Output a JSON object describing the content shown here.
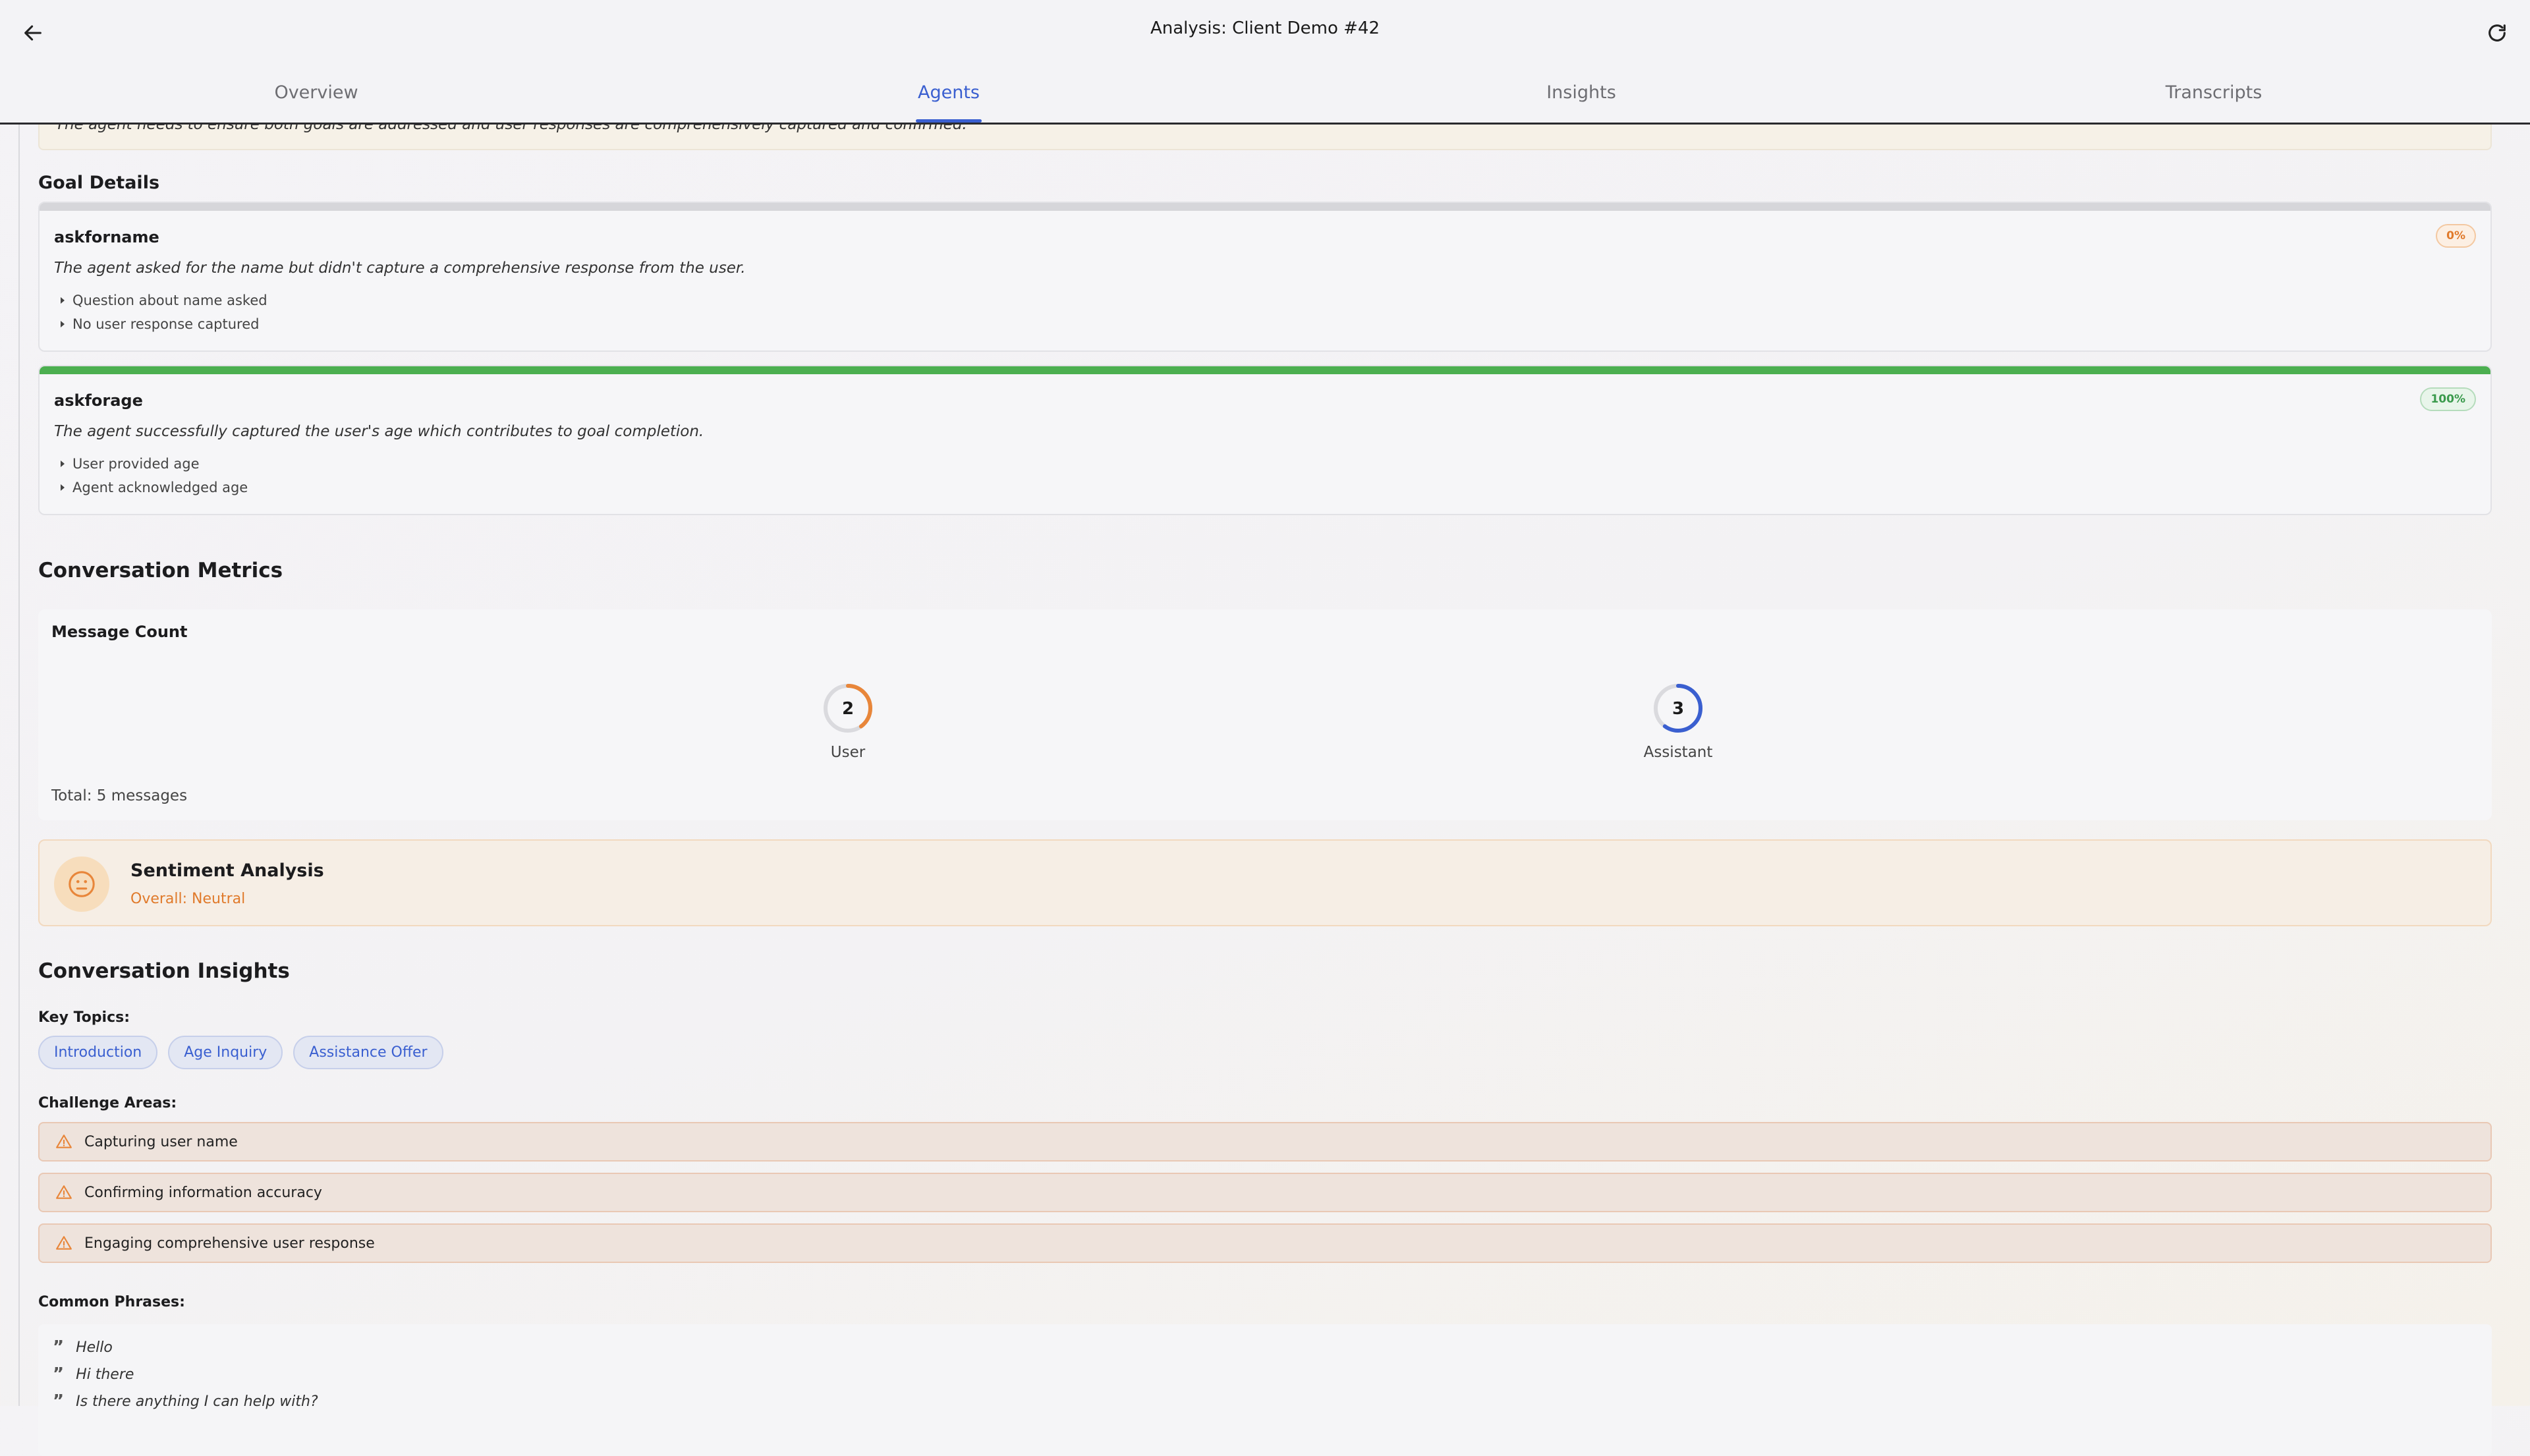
{
  "header": {
    "title": "Analysis: Client Demo #42",
    "tabs": [
      {
        "label": "Overview"
      },
      {
        "label": "Agents"
      },
      {
        "label": "Insights"
      },
      {
        "label": "Transcripts"
      }
    ],
    "active_tab": "Agents"
  },
  "banner": {
    "text": "The agent needs to ensure both goals are addressed and user responses are comprehensively captured and confirmed."
  },
  "goal_details": {
    "title": "Goal Details",
    "goals": [
      {
        "name": "askforname",
        "percent": 0,
        "percent_label": "0%",
        "description": "The agent asked for the name but didn't capture a comprehensive response from the user.",
        "points": [
          "Question about name asked",
          "No user response captured"
        ]
      },
      {
        "name": "askforage",
        "percent": 100,
        "percent_label": "100%",
        "description": "The agent successfully captured the user's age which contributes to goal completion.",
        "points": [
          "User provided age",
          "Agent acknowledged age"
        ]
      }
    ]
  },
  "metrics": {
    "title": "Conversation Metrics",
    "card_title": "Message Count",
    "user": {
      "count": "2",
      "label": "User",
      "fraction": 0.4,
      "color": "#e8863a"
    },
    "assistant": {
      "count": "3",
      "label": "Assistant",
      "fraction": 0.6,
      "color": "#3a5fd0"
    },
    "total": "Total: 5 messages"
  },
  "sentiment": {
    "title": "Sentiment Analysis",
    "overall": "Overall: Neutral",
    "icon": "neutral-face-icon"
  },
  "insights": {
    "title": "Conversation Insights",
    "key_topics_label": "Key Topics:",
    "key_topics": [
      "Introduction",
      "Age Inquiry",
      "Assistance Offer"
    ],
    "challenge_label": "Challenge Areas:",
    "challenges": [
      "Capturing user name",
      "Confirming information accuracy",
      "Engaging comprehensive user response"
    ],
    "phrases_label": "Common Phrases:",
    "phrases": [
      "Hello",
      "Hi there",
      "Is there anything I can help with?"
    ]
  },
  "colors": {
    "accent": "#3a5fd0",
    "warning": "#e07a2b",
    "success": "#4caf50"
  }
}
